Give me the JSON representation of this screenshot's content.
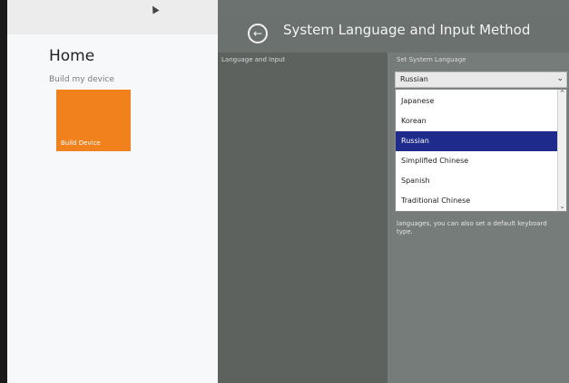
{
  "home": {
    "title": "Home",
    "subtitle": "Build my device",
    "tile_label": "Build Device"
  },
  "header": {
    "title": "System Language and Input Method",
    "back_icon": "back-arrow-icon"
  },
  "columns": {
    "left_header": "Language and Input",
    "right_header": "Set System Language"
  },
  "select": {
    "value": "Russian",
    "chevron": "⌄"
  },
  "dropdown": {
    "items": [
      {
        "label": "Japanese"
      },
      {
        "label": "Korean"
      },
      {
        "label": "Russian"
      },
      {
        "label": "Simplified Chinese"
      },
      {
        "label": "Spanish"
      },
      {
        "label": "Traditional Chinese"
      }
    ],
    "selected_index": 2,
    "scroll_up": "^",
    "scroll_down": "⌄"
  },
  "description": "languages, you can also set a default keyboard type.",
  "colors": {
    "tile": "#f0811d",
    "selected": "#1f2b8a"
  }
}
